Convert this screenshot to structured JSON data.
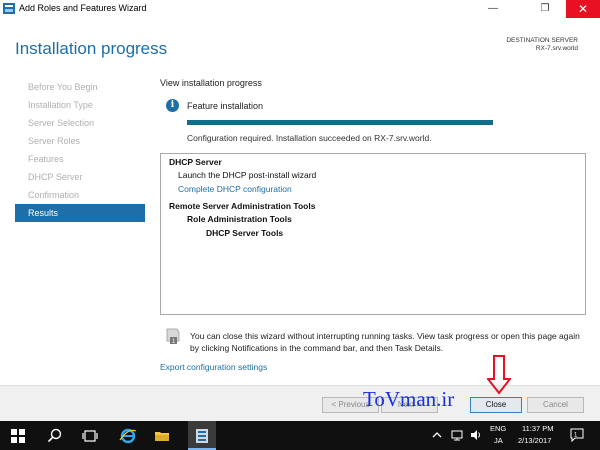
{
  "window": {
    "title": "Add Roles and Features Wizard",
    "minimize_glyph": "—",
    "maximize_glyph": "❐",
    "close_glyph": "✕"
  },
  "header": {
    "title": "Installation progress",
    "destination_label": "DESTINATION SERVER",
    "destination_value": "RX-7.srv.world"
  },
  "nav": {
    "items": [
      {
        "label": "Before You Begin",
        "active": false
      },
      {
        "label": "Installation Type",
        "active": false
      },
      {
        "label": "Server Selection",
        "active": false
      },
      {
        "label": "Server Roles",
        "active": false
      },
      {
        "label": "Features",
        "active": false
      },
      {
        "label": "DHCP Server",
        "active": false
      },
      {
        "label": "Confirmation",
        "active": false
      },
      {
        "label": "Results",
        "active": true
      }
    ]
  },
  "content": {
    "section_label": "View installation progress",
    "info_glyph": "i",
    "feature_label": "Feature installation",
    "progress_fraction": 1.0,
    "status": "Configuration required. Installation succeeded on RX-7.srv.world.",
    "results": {
      "dhcp_server": "DHCP Server",
      "launch_wizard": "Launch the DHCP post-install wizard",
      "complete_link": "Complete DHCP configuration",
      "rsat": "Remote Server Administration Tools",
      "role_tools": "Role Administration Tools",
      "dhcp_tools": "DHCP Server Tools"
    },
    "note": "You can close this wizard without interrupting running tasks. View task progress or open this page again by clicking Notifications in the command bar, and then Task Details.",
    "export_link": "Export configuration settings"
  },
  "footer": {
    "previous": "< Previous",
    "next": "Next >",
    "close": "Close",
    "cancel": "Cancel"
  },
  "watermark": "ToVman.ir",
  "taskbar": {
    "lang_top": "ENG",
    "lang_bottom": "JA",
    "time": "11:37 PM",
    "date": "2/13/2017"
  },
  "colors": {
    "accent": "#1e6ea7",
    "progress": "#176b8a",
    "close_red": "#e81123",
    "watermark": "#1a2fe6"
  }
}
